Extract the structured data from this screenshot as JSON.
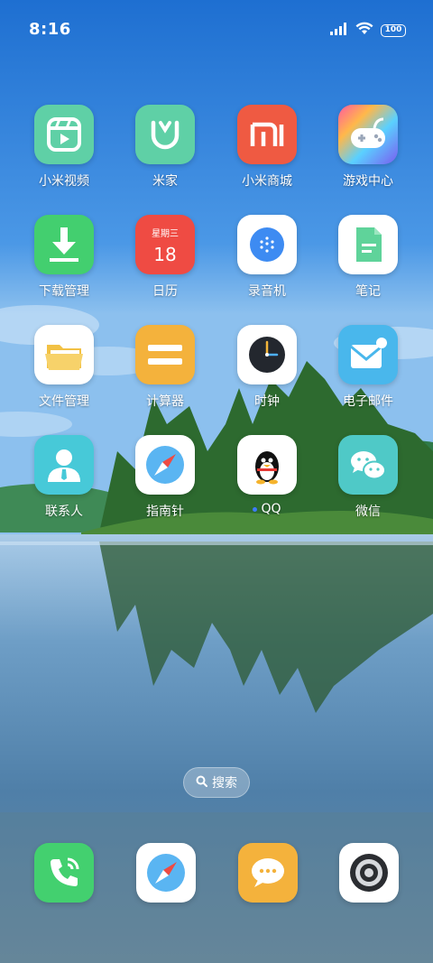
{
  "status_bar": {
    "time": "8:16",
    "battery": "100",
    "icons": [
      "signal-icon",
      "wifi-icon",
      "battery-icon"
    ]
  },
  "apps": [
    {
      "label": "小米视频",
      "icon": "play-icon",
      "color": "#5fd0a6"
    },
    {
      "label": "米家",
      "icon": "mijia-icon",
      "color": "#5fd0a6"
    },
    {
      "label": "小米商城",
      "icon": "mi-logo-icon",
      "color": "#ef5a42"
    },
    {
      "label": "游戏中心",
      "icon": "gamepad-icon",
      "color": "#7a5cf0"
    },
    {
      "label": "下载管理",
      "icon": "download-icon",
      "color": "#43cf6f"
    },
    {
      "label": "日历",
      "icon": "calendar-icon",
      "color": "#ef4b43",
      "weekday": "星期三",
      "day": "18"
    },
    {
      "label": "录音机",
      "icon": "microphone-icon",
      "color": "#ffffff"
    },
    {
      "label": "笔记",
      "icon": "note-icon",
      "color": "#ffffff"
    },
    {
      "label": "文件管理",
      "icon": "folder-icon",
      "color": "#ffffff"
    },
    {
      "label": "计算器",
      "icon": "calculator-icon",
      "color": "#f4b23c"
    },
    {
      "label": "时钟",
      "icon": "clock-icon",
      "color": "#ffffff"
    },
    {
      "label": "电子邮件",
      "icon": "mail-icon",
      "color": "#49b7ec"
    },
    {
      "label": "联系人",
      "icon": "contact-icon",
      "color": "#47c9d8"
    },
    {
      "label": "指南针",
      "icon": "compass-icon",
      "color": "#ffffff"
    },
    {
      "label": "QQ",
      "icon": "qq-penguin-icon",
      "color": "#ffffff"
    },
    {
      "label": "微信",
      "icon": "wechat-icon",
      "color": "#4fc9c7"
    }
  ],
  "search": {
    "label": "搜索"
  },
  "dock": [
    {
      "name": "phone",
      "icon": "phone-icon",
      "color": "#43d06f"
    },
    {
      "name": "browser",
      "icon": "compass-icon",
      "color": "#ffffff"
    },
    {
      "name": "messages",
      "icon": "message-icon",
      "color": "#f4b23c"
    },
    {
      "name": "camera",
      "icon": "camera-icon",
      "color": "#ffffff"
    }
  ]
}
